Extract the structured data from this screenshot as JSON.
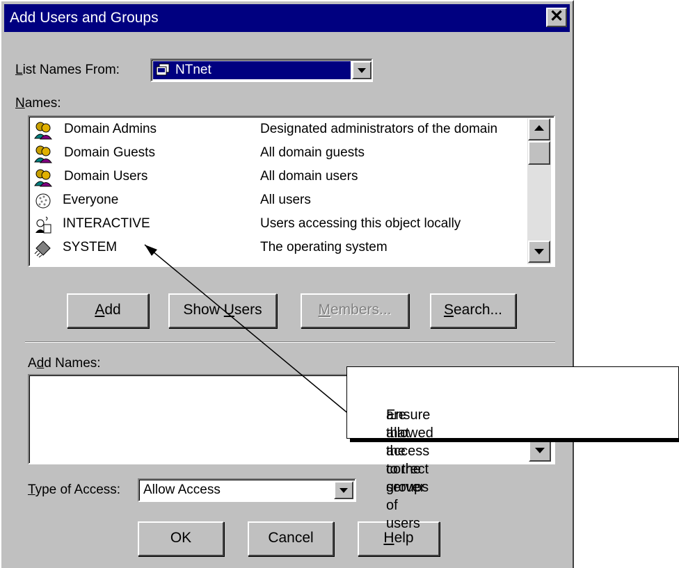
{
  "dialog": {
    "title": "Add Users and Groups",
    "close_glyph": "✕"
  },
  "list_names_from": {
    "label": "List Names From:",
    "value": "NTnet",
    "icon": "server-icon"
  },
  "names": {
    "label": "Names:",
    "rows": [
      {
        "name": "Domain Admins",
        "description": "Designated administrators of the domain",
        "icon": "group-icon"
      },
      {
        "name": "Domain Guests",
        "description": "All domain guests",
        "icon": "group-icon"
      },
      {
        "name": "Domain Users",
        "description": "All domain users",
        "icon": "group-icon"
      },
      {
        "name": "Everyone",
        "description": "All users",
        "icon": "globe-icon"
      },
      {
        "name": "INTERACTIVE",
        "description": "Users accessing this object locally",
        "icon": "interactive-user-icon"
      },
      {
        "name": "SYSTEM",
        "description": "The operating system",
        "icon": "chip-icon"
      }
    ]
  },
  "buttons": {
    "add": "Add",
    "show_users": "Show Users",
    "members": "Members...",
    "search": "Search..."
  },
  "add_names": {
    "label": "Add Names:",
    "value": ""
  },
  "type_of_access": {
    "label": "Type of Access:",
    "value": "Allow Access"
  },
  "footer": {
    "ok": "OK",
    "cancel": "Cancel",
    "help": "Help"
  },
  "callout": {
    "text_line1": "Ensure that the correct groups of users",
    "text_line2": "are allowed access to the server"
  },
  "colors": {
    "titlebar": "#000080",
    "face": "#c0c0c0",
    "selection": "#000080"
  }
}
